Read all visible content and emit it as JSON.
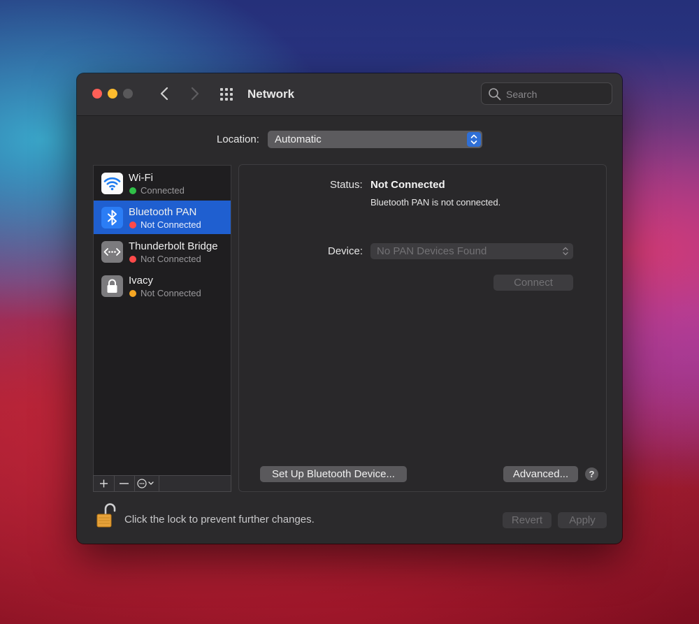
{
  "window": {
    "title": "Network",
    "search": {
      "placeholder": "Search"
    }
  },
  "location": {
    "label": "Location:",
    "value": "Automatic"
  },
  "services": [
    {
      "name": "Wi-Fi",
      "status": "Connected",
      "status_color": "#30c048",
      "icon": "wifi-icon",
      "selected": false
    },
    {
      "name": "Bluetooth PAN",
      "status": "Not Connected",
      "status_color": "#fe4a4a",
      "icon": "bluetooth-icon",
      "selected": true
    },
    {
      "name": "Thunderbolt Bridge",
      "status": "Not Connected",
      "status_color": "#fe4a4a",
      "icon": "thunderbolt-bridge-icon",
      "selected": false
    },
    {
      "name": "Ivacy",
      "status": "Not Connected",
      "status_color": "#f5a623",
      "icon": "vpn-lock-icon",
      "selected": false
    }
  ],
  "sidebar_controls": {
    "add": "+",
    "remove": "−",
    "action": "action-menu-icon"
  },
  "detail": {
    "status_label": "Status:",
    "status_value": "Not Connected",
    "status_description": "Bluetooth PAN is not connected.",
    "device_label": "Device:",
    "device_value": "No PAN Devices Found",
    "connect_label": "Connect",
    "setup_label": "Set Up Bluetooth Device...",
    "advanced_label": "Advanced...",
    "help_label": "?"
  },
  "footer": {
    "lock_text": "Click the lock to prevent further changes.",
    "revert_label": "Revert",
    "apply_label": "Apply"
  },
  "colors": {
    "accent": "#1f5fd0",
    "close": "#fe5f57",
    "minimize": "#febc2e"
  }
}
